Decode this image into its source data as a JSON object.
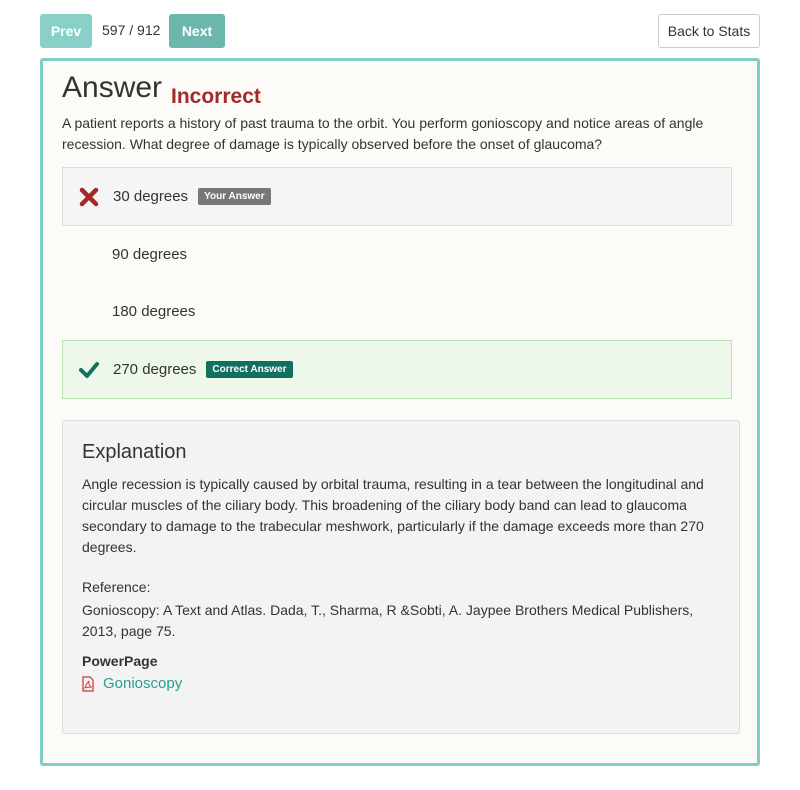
{
  "nav": {
    "prev_label": "Prev",
    "counter": "597 / 912",
    "next_label": "Next",
    "back_label": "Back to Stats"
  },
  "answer": {
    "heading": "Answer",
    "result": "Incorrect",
    "question": "A patient reports a history of past trauma to the orbit. You perform gonioscopy and notice areas of angle recession. What degree of damage is typically observed before the onset of glaucoma?"
  },
  "options": [
    {
      "label": "30 degrees",
      "badge": "Your Answer",
      "state": "wrong"
    },
    {
      "label": "90 degrees",
      "badge": "",
      "state": "none"
    },
    {
      "label": "180 degrees",
      "badge": "",
      "state": "none"
    },
    {
      "label": "270 degrees",
      "badge": "Correct Answer",
      "state": "correct"
    }
  ],
  "explanation": {
    "title": "Explanation",
    "body": "Angle recession is typically caused by orbital trauma, resulting in a tear between the longitudinal and circular muscles of the ciliary body. This broadening of the ciliary body band can lead to glaucoma secondary to damage to the trabecular meshwork, particularly if the damage exceeds more than 270 degrees.",
    "reference_label": "Reference:",
    "reference_text": "Gonioscopy: A Text and Atlas. Dada, T., Sharma, R &Sobti, A. Jaypee Brothers Medical Publishers, 2013, page 75.",
    "powerpage_label": "PowerPage",
    "powerpage_link": "Gonioscopy"
  },
  "colors": {
    "accent": "#7fcfc6",
    "incorrect": "#a12a2a",
    "correct": "#127060",
    "link": "#2a9d8f"
  },
  "icons": {
    "wrong": "x-mark-icon",
    "correct": "checkmark-icon",
    "document": "pdf-file-icon"
  }
}
